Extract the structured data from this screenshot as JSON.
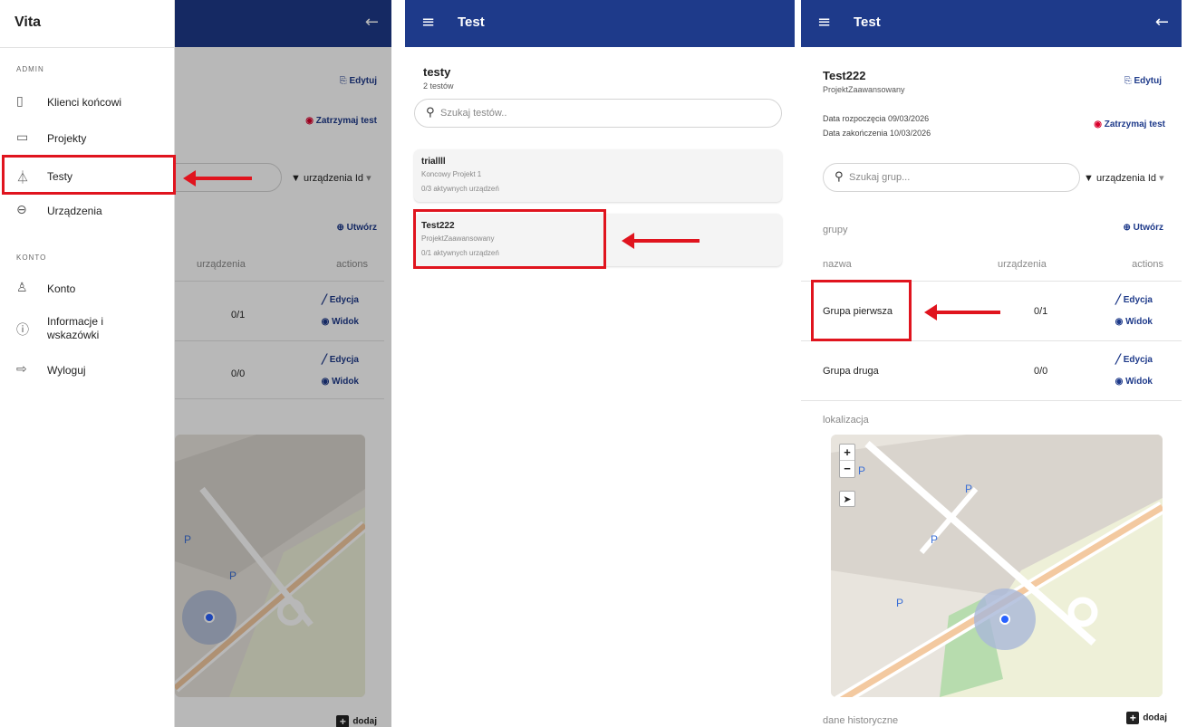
{
  "drawer": {
    "title": "Vita",
    "admin_section": "ADMIN",
    "konto_section": "KONTO",
    "items": [
      {
        "label": "Klienci końcowi",
        "icon": "building-icon"
      },
      {
        "label": "Projekty",
        "icon": "folder-icon"
      },
      {
        "label": "Testy",
        "icon": "flask-icon"
      },
      {
        "label": "Urządzenia",
        "icon": "link-icon"
      },
      {
        "label": "Konto",
        "icon": "user-icon"
      },
      {
        "label": "Informacje i wskazówki",
        "icon": "info-icon"
      },
      {
        "label": "Wyloguj",
        "icon": "logout-icon"
      }
    ]
  },
  "panel1": {
    "edit": "Edytuj",
    "stop": "Zatrzymaj test",
    "filter": "urządzenia Id",
    "create": "Utwórz",
    "col_devices": "urządzenia",
    "col_actions": "actions",
    "rows": [
      {
        "devices": "0/1",
        "edit": "Edycja",
        "view": "Widok"
      },
      {
        "devices": "0/0",
        "edit": "Edycja",
        "view": "Widok"
      }
    ],
    "add": "dodaj"
  },
  "panel2": {
    "appbar_title": "Test",
    "heading": "testy",
    "count": "2 testów",
    "search_placeholder": "Szukaj testów..",
    "tests": [
      {
        "name": "triallll",
        "project": "Koncowy Projekt 1",
        "active": "0/3 aktywnych urządzeń"
      },
      {
        "name": "Test222",
        "project": "ProjektZaawansowany",
        "active": "0/1 aktywnych urządzeń"
      }
    ]
  },
  "panel3": {
    "appbar_title": "Test",
    "name": "Test222",
    "project": "ProjektZaawansowany",
    "edit": "Edytuj",
    "start": "Data rozpoczęcia 09/03/2026",
    "end": "Data zakończenia 10/03/2026",
    "stop": "Zatrzymaj test",
    "search_placeholder": "Szukaj grup...",
    "filter": "urządzenia Id",
    "groups_label": "grupy",
    "create": "Utwórz",
    "col_name": "nazwa",
    "col_devices": "urządzenia",
    "col_actions": "actions",
    "rows": [
      {
        "name": "Grupa pierwsza",
        "devices": "0/1",
        "edit": "Edycja",
        "view": "Widok"
      },
      {
        "name": "Grupa druga",
        "devices": "0/0",
        "edit": "Edycja",
        "view": "Widok"
      }
    ],
    "location_label": "lokalizacja",
    "history_label": "dane historyczne",
    "add": "dodaj",
    "zoom_in": "+",
    "zoom_out": "−"
  },
  "colors": {
    "appbar": "#1e3a8a",
    "accent": "#1e3a8a",
    "highlight": "#e0141e"
  }
}
